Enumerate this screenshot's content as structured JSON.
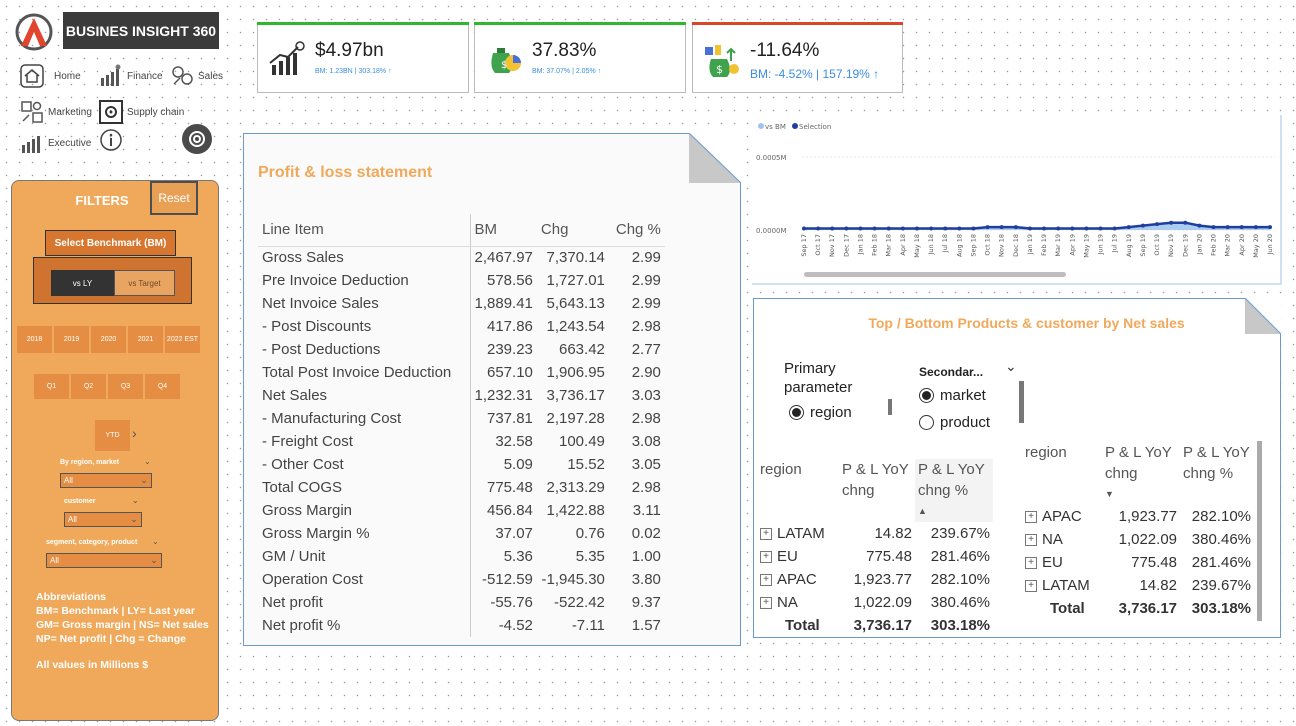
{
  "brand": {
    "title": "BUSINES INSIGHT 360"
  },
  "nav": {
    "home": "Home",
    "finance": "Finance",
    "sales": "Sales",
    "marketing": "Marketing",
    "supply_chain": "Supply chain",
    "executive": "Executive"
  },
  "filters": {
    "title": "FILTERS",
    "reset": "Reset",
    "benchmark_label": "Select Benchmark (BM)",
    "benchmark_options": [
      "vs LY",
      "vs Target"
    ],
    "benchmark_selected": "vs LY",
    "years": [
      "2018",
      "2019",
      "2020",
      "2021",
      "2022 EST"
    ],
    "quarters": [
      "Q1",
      "Q2",
      "Q3",
      "Q4"
    ],
    "ytd": "YTD",
    "region_label": "By region, market",
    "region_value": "All",
    "customer_label": "customer",
    "customer_value": "All",
    "segment_label": "segment, category, product",
    "segment_value": "All",
    "abbreviations": [
      "Abbreviations",
      "BM= Benchmark | LY= Last year",
      "GM= Gross margin | NS= Net sales",
      "NP= Net profit | Chg = Change",
      "All values in Millions $"
    ]
  },
  "kpis": [
    {
      "value": "$4.97bn",
      "sub": "BM: 1.23BN | 303.18% ↑",
      "color": "#2eb82e"
    },
    {
      "value": "37.83%",
      "sub": "BM: 37.07% | 2.05% ↑",
      "color": "#2eb82e"
    },
    {
      "value": "-11.64%",
      "sub": "BM: -4.52% | 157.19% ↑",
      "color": "#d9472b"
    }
  ],
  "pnl": {
    "title": "Profit & loss statement",
    "columns": [
      "Line Item",
      "BM",
      "Chg",
      "Chg %"
    ],
    "rows": [
      [
        "Gross Sales",
        "2,467.97",
        "7,370.14",
        "2.99"
      ],
      [
        "Pre Invoice Deduction",
        "578.56",
        "1,727.01",
        "2.99"
      ],
      [
        "Net Invoice Sales",
        "1,889.41",
        "5,643.13",
        "2.99"
      ],
      [
        "- Post Discounts",
        "417.86",
        "1,243.54",
        "2.98"
      ],
      [
        "- Post Deductions",
        "239.23",
        "663.42",
        "2.77"
      ],
      [
        "Total Post Invoice Deduction",
        "657.10",
        "1,906.95",
        "2.90"
      ],
      [
        "Net Sales",
        "1,232.31",
        "3,736.17",
        "3.03"
      ],
      [
        "- Manufacturing Cost",
        "737.81",
        "2,197.28",
        "2.98"
      ],
      [
        "- Freight Cost",
        "32.58",
        "100.49",
        "3.08"
      ],
      [
        "- Other Cost",
        "5.09",
        "15.52",
        "3.05"
      ],
      [
        "Total COGS",
        "775.48",
        "2,313.29",
        "2.98"
      ],
      [
        "Gross Margin",
        "456.84",
        "1,422.88",
        "3.11"
      ],
      [
        "Gross Margin %",
        "37.07",
        "0.76",
        "0.02"
      ],
      [
        "GM / Unit",
        "5.36",
        "5.35",
        "1.00"
      ],
      [
        "Operation Cost",
        "-512.59",
        "-1,945.30",
        "3.80"
      ],
      [
        "Net profit",
        "-55.76",
        "-522.42",
        "9.37"
      ],
      [
        "Net profit %",
        "-4.52",
        "-7.11",
        "1.57"
      ]
    ]
  },
  "chart_data": {
    "type": "area",
    "legend": [
      "vs BM",
      "Selection"
    ],
    "legend_position": "top-left",
    "colors": {
      "vs BM": "#9ec3f0",
      "Selection": "#1f3f9e"
    },
    "y_ticks": [
      "0.0005M",
      "0.0000M"
    ],
    "ylim": [
      0,
      0.0005
    ],
    "categories": [
      "Sep 17",
      "Oct 17",
      "Nov 17",
      "Dec 17",
      "Jan 18",
      "Feb 18",
      "Mar 18",
      "Apr 18",
      "May 18",
      "Jun 18",
      "Jul 18",
      "Aug 18",
      "Sep 18",
      "Oct 18",
      "Nov 18",
      "Dec 18",
      "Jan 19",
      "Feb 19",
      "Mar 19",
      "Apr 19",
      "May 19",
      "Jun 19",
      "Jul 19",
      "Aug 19",
      "Sep 19",
      "Oct 19",
      "Nov 19",
      "Dec 19",
      "Jan 20",
      "Feb 20",
      "Mar 20",
      "Apr 20",
      "May 20",
      "Jun 20"
    ],
    "series": [
      {
        "name": "vs BM",
        "values": [
          1e-05,
          1e-05,
          1e-05,
          1e-05,
          1e-05,
          1e-05,
          1e-05,
          1e-05,
          1e-05,
          1e-05,
          1e-05,
          1e-05,
          1e-05,
          1e-05,
          2e-05,
          2e-05,
          1e-05,
          1e-05,
          1e-05,
          1e-05,
          1e-05,
          1e-05,
          1e-05,
          2e-05,
          3e-05,
          4e-05,
          5e-05,
          5e-05,
          3e-05,
          2e-05,
          2e-05,
          2e-05,
          2e-05,
          2e-05
        ]
      },
      {
        "name": "Selection",
        "values": [
          1e-05,
          1e-05,
          1e-05,
          1e-05,
          1e-05,
          1e-05,
          1e-05,
          1e-05,
          1e-05,
          1e-05,
          1e-05,
          1e-05,
          1e-05,
          2e-05,
          2e-05,
          2e-05,
          1e-05,
          1e-05,
          1e-05,
          1e-05,
          1e-05,
          1e-05,
          1e-05,
          2e-05,
          3e-05,
          4e-05,
          5e-05,
          5e-05,
          3e-05,
          2e-05,
          2e-05,
          2e-05,
          2e-05,
          2e-05
        ]
      }
    ]
  },
  "topbottom": {
    "title": "Top  / Bottom Products & customer by Net sales",
    "primary_label": "Primary parameter",
    "primary_options": [
      "region"
    ],
    "primary_selected": "region",
    "secondary_label": "Secondar...",
    "secondary_options": [
      "market",
      "product"
    ],
    "secondary_selected": "market",
    "left": {
      "columns": [
        "region",
        "P & L YoY chng",
        "P & L YoY chng %"
      ],
      "rows": [
        [
          "LATAM",
          "14.82",
          "239.67%"
        ],
        [
          "EU",
          "775.48",
          "281.46%"
        ],
        [
          "APAC",
          "1,923.77",
          "282.10%"
        ],
        [
          "NA",
          "1,022.09",
          "380.46%"
        ]
      ],
      "total": [
        "Total",
        "3,736.17",
        "303.18%"
      ]
    },
    "right": {
      "columns": [
        "region",
        "P & L YoY chng",
        "P & L YoY chng %"
      ],
      "rows": [
        [
          "APAC",
          "1,923.77",
          "282.10%"
        ],
        [
          "NA",
          "1,022.09",
          "380.46%"
        ],
        [
          "EU",
          "775.48",
          "281.46%"
        ],
        [
          "LATAM",
          "14.82",
          "239.67%"
        ]
      ],
      "total": [
        "Total",
        "3,736.17",
        "303.18%"
      ]
    }
  }
}
